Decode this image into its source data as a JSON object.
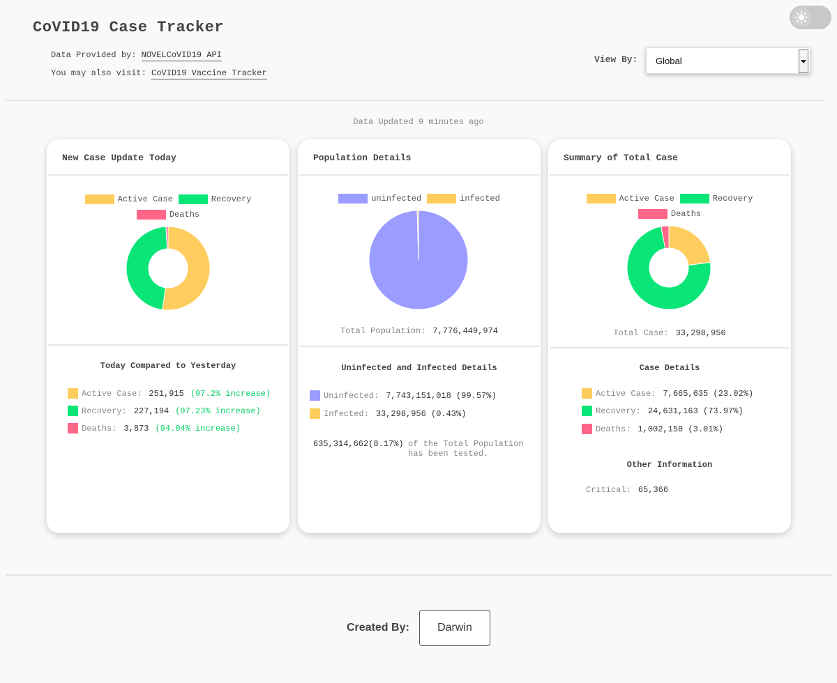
{
  "header": {
    "title": "CoVID19 Case Tracker",
    "provided_label": "Data Provided by:",
    "provided_link": "NOVELCoVID19 API",
    "visit_label": "You may also visit:",
    "visit_link": "CoVID19 Vaccine Tracker",
    "view_by_label": "View By:",
    "view_by_value": "Global",
    "theme_icon": "sun-icon"
  },
  "updated": "Data Updated 9 minutes ago",
  "colors": {
    "active": "#fecd5d",
    "recovery": "#09e677",
    "deaths": "#ff6688",
    "uninfected": "#9b9cff",
    "infected": "#fecd5d",
    "increase": "#07d266"
  },
  "cards": {
    "today": {
      "title": "New Case Update Today",
      "legend": [
        "Active Case",
        "Recovery",
        "Deaths"
      ],
      "compare_title": "Today Compared to Yesterday",
      "active_label": "Active Case:",
      "active_value": "251,915",
      "active_change": "(97.2% increase)",
      "recovery_label": "Recovery:",
      "recovery_value": "227,194",
      "recovery_change": "(97.23% increase)",
      "deaths_label": "Deaths:",
      "deaths_value": "3,873",
      "deaths_change": "(94.04% increase)"
    },
    "population": {
      "title": "Population Details",
      "legend": [
        "uninfected",
        "infected"
      ],
      "total_label": "Total Population:",
      "total_value": "7,776,449,974",
      "details_title": "Uninfected and Infected Details",
      "uninfected_label": "Uninfected:",
      "uninfected_value": "7,743,151,018 (99.57%)",
      "infected_label": "Infected:",
      "infected_value": "33,298,956 (0.43%)",
      "tested_value": "635,314,662(8.17%)",
      "tested_text_1": "of the Total Population",
      "tested_text_2": "has been tested."
    },
    "summary": {
      "title": "Summary of Total Case",
      "legend": [
        "Active Case",
        "Recovery",
        "Deaths"
      ],
      "total_label": "Total Case:",
      "total_value": "33,298,956",
      "details_title": "Case Details",
      "active_label": "Active Case:",
      "active_value": "7,665,635 (23.02%)",
      "recovery_label": "Recovery:",
      "recovery_value": "24,631,163 (73.97%)",
      "deaths_label": "Deaths:",
      "deaths_value": "1,002,158 (3.01%)",
      "other_title": "Other Information",
      "critical_label": "Critical:",
      "critical_value": "65,366"
    }
  },
  "footer": {
    "created_label": "Created By:",
    "author": "Darwin"
  },
  "chart_data": [
    {
      "type": "pie",
      "variant": "doughnut",
      "labels": [
        "Active Case",
        "Recovery",
        "Deaths"
      ],
      "values": [
        251915,
        227194,
        3873
      ]
    },
    {
      "type": "pie",
      "labels": [
        "uninfected",
        "infected"
      ],
      "values": [
        7743151018,
        33298956
      ]
    },
    {
      "type": "pie",
      "variant": "doughnut",
      "labels": [
        "Active Case",
        "Recovery",
        "Deaths"
      ],
      "values": [
        7665635,
        24631163,
        1002158
      ]
    }
  ]
}
